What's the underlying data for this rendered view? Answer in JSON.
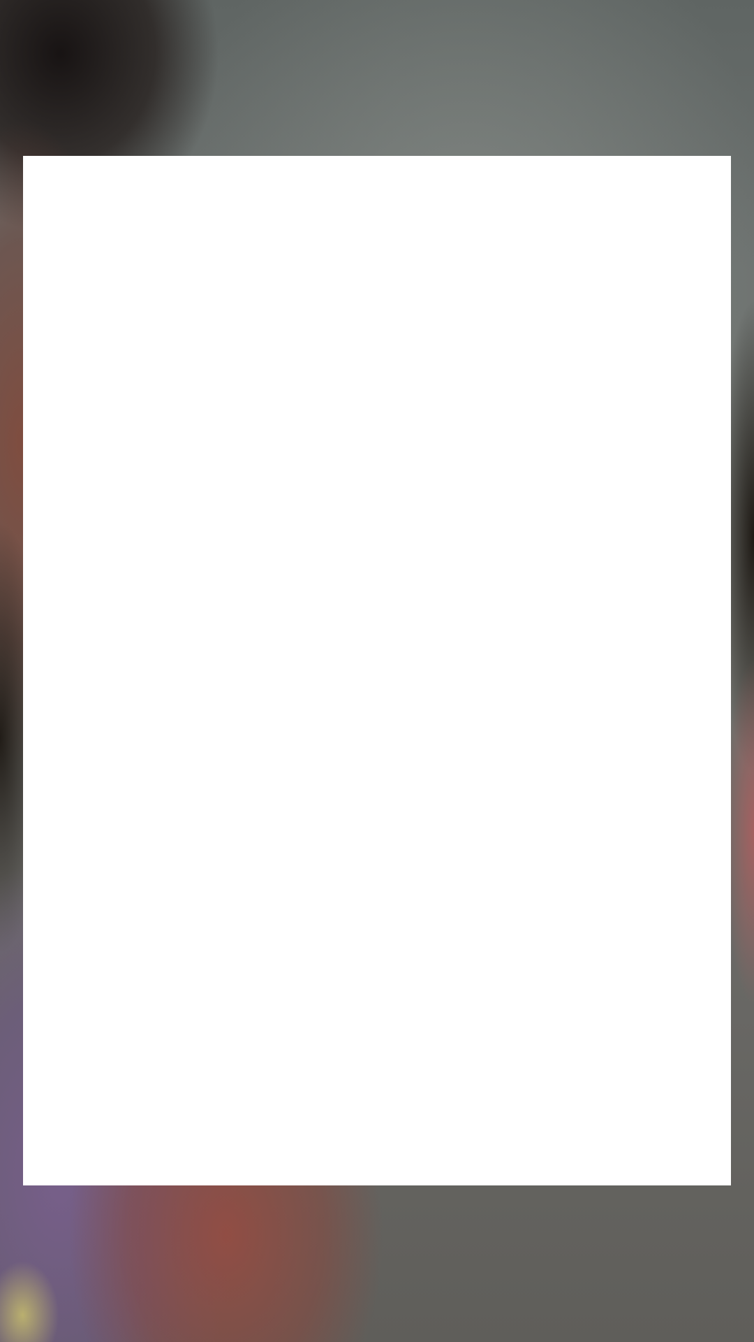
{
  "scene": {
    "background_colors": {
      "wall": "#70726d",
      "hair": "#1e1714",
      "skin": "#8a4a3c",
      "shirt": "#786090",
      "red_fabric": "#964b41"
    },
    "card_color": "#ffffff"
  }
}
